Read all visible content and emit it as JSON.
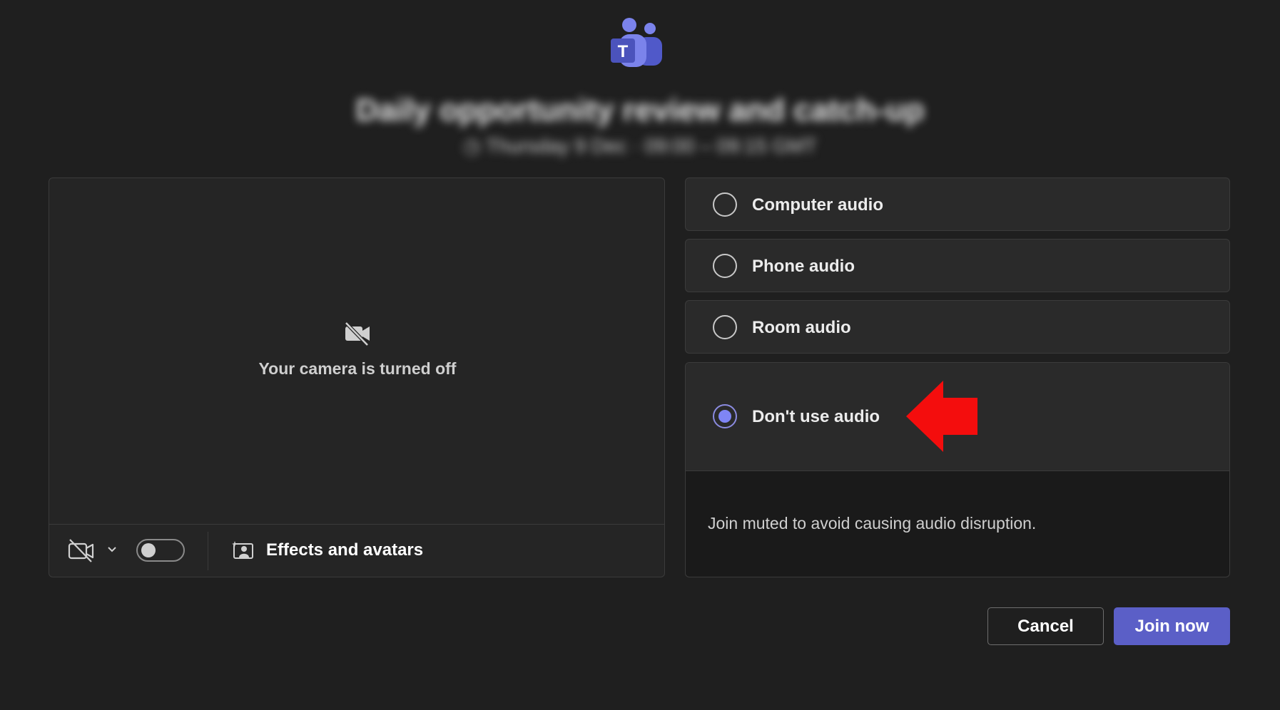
{
  "meeting": {
    "title": "Daily opportunity review and catch-up",
    "time": "◷ Thursday 9 Dec · 09:00 – 09:15 GMT"
  },
  "preview": {
    "camera_off_text": "Your camera is turned off",
    "camera_toggle_on": false,
    "effects_label": "Effects and avatars"
  },
  "audio_options": [
    {
      "label": "Computer audio",
      "selected": false
    },
    {
      "label": "Phone audio",
      "selected": false
    },
    {
      "label": "Room audio",
      "selected": false
    },
    {
      "label": "Don't use audio",
      "selected": true,
      "description": "Join muted to avoid causing audio disruption."
    }
  ],
  "buttons": {
    "cancel": "Cancel",
    "join": "Join now"
  },
  "colors": {
    "accent": "#5b5fc7",
    "radio_selected": "#7f85f5",
    "annotation_arrow": "#f40d0d",
    "background": "#1f1f1f"
  },
  "icons": {
    "logo": "teams-logo-icon",
    "camera_off": "video-off-icon",
    "effects": "effects-avatars-icon",
    "chevron": "chevron-down-icon"
  }
}
